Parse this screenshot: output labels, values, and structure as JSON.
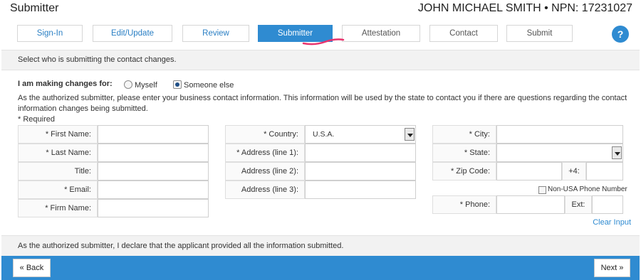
{
  "header": {
    "title": "Submitter",
    "user": "JOHN MICHAEL SMITH • NPN: 17231027"
  },
  "steps": [
    {
      "label": "Sign-In",
      "state": "done"
    },
    {
      "label": "Edit/Update",
      "state": "done"
    },
    {
      "label": "Review",
      "state": "done"
    },
    {
      "label": "Submitter",
      "state": "active"
    },
    {
      "label": "Attestation",
      "state": "future"
    },
    {
      "label": "Contact",
      "state": "future"
    },
    {
      "label": "Submit",
      "state": "future"
    }
  ],
  "help_label": "?",
  "instruction": "Select who is submitting the contact changes.",
  "making_changes": {
    "label": "I am making changes for:",
    "options": [
      {
        "label": "Myself",
        "checked": false
      },
      {
        "label": "Someone else",
        "checked": true
      }
    ]
  },
  "description": "As the authorized submitter, please enter your business contact information. This information will be used by the state to contact you if there are questions regarding the contact information changes being submitted.",
  "required_note": "* Required",
  "form": {
    "first_name": {
      "label": "* First Name:",
      "value": ""
    },
    "last_name": {
      "label": "* Last Name:",
      "value": ""
    },
    "title": {
      "label": "Title:",
      "value": ""
    },
    "email": {
      "label": "* Email:",
      "value": ""
    },
    "firm_name": {
      "label": "* Firm Name:",
      "value": ""
    },
    "country": {
      "label": "* Country:",
      "value": "U.S.A."
    },
    "address1": {
      "label": "* Address (line 1):",
      "value": ""
    },
    "address2": {
      "label": "Address (line 2):",
      "value": ""
    },
    "address3": {
      "label": "Address (line 3):",
      "value": ""
    },
    "city": {
      "label": "* City:",
      "value": ""
    },
    "state": {
      "label": "* State:",
      "value": ""
    },
    "zip": {
      "label": "* Zip Code:",
      "value": "",
      "plus4_label": "+4:",
      "plus4_value": ""
    },
    "non_usa_phone": {
      "label": "Non-USA Phone Number",
      "checked": false
    },
    "phone": {
      "label": "* Phone:",
      "value": "",
      "ext_label": "Ext:",
      "ext_value": ""
    }
  },
  "clear_input": "Clear Input",
  "declaration": "As the authorized submitter, I declare that the applicant provided all the information submitted.",
  "footer": {
    "back_label": "« Back",
    "next_label": "Next »"
  },
  "colors": {
    "accent": "#2f8bd1",
    "swoosh": "#e8336d"
  }
}
